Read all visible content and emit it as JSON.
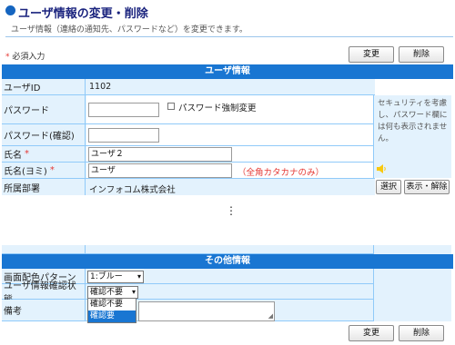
{
  "page": {
    "title": "ユーザ情報の変更・削除",
    "subtitle": "ユーザ情報（連絡の通知先、パスワードなど）を変更できます。",
    "required_note_star": "*",
    "required_note": "必須入力"
  },
  "toolbar": {
    "change_label": "変更",
    "delete_label": "削除"
  },
  "user_section": {
    "header": "ユーザ情報",
    "user_id_label": "ユーザID",
    "user_id_value": "1102",
    "password_label": "パスワード",
    "password_value": "",
    "force_change_label": "パスワード強制変更",
    "password_confirm_label": "パスワード(確認)",
    "password_confirm_value": "",
    "password_note": "セキュリティを考慮し、パスワード欄には何も表示されません。",
    "name_label": "氏名",
    "name_value": "ユーザ２",
    "name_kana_label": "氏名(ヨミ)",
    "name_kana_value": "ユーザ",
    "name_kana_hint": "（全角カタカナのみ）",
    "department_label": "所属部署",
    "department_value": "インフォコム株式会社",
    "select_button": "選択",
    "display_release_button": "表示・解除",
    "required_mark": "*"
  },
  "other_section": {
    "header": "その他情報",
    "color_pattern_label": "画面配色パターン",
    "color_pattern_value": "1:ブルー",
    "confirm_status_label": "ユーザ情報確認状態",
    "confirm_status_value": "確認不要",
    "confirm_status_options": [
      "確認不要",
      "確認要"
    ],
    "remarks_label": "備考"
  },
  "separator": "⋮",
  "colors": {
    "accent": "#1976d2",
    "row_bg": "#e3f2fd",
    "required": "#e53935"
  },
  "icons": {
    "speaker": "speaker-icon"
  }
}
